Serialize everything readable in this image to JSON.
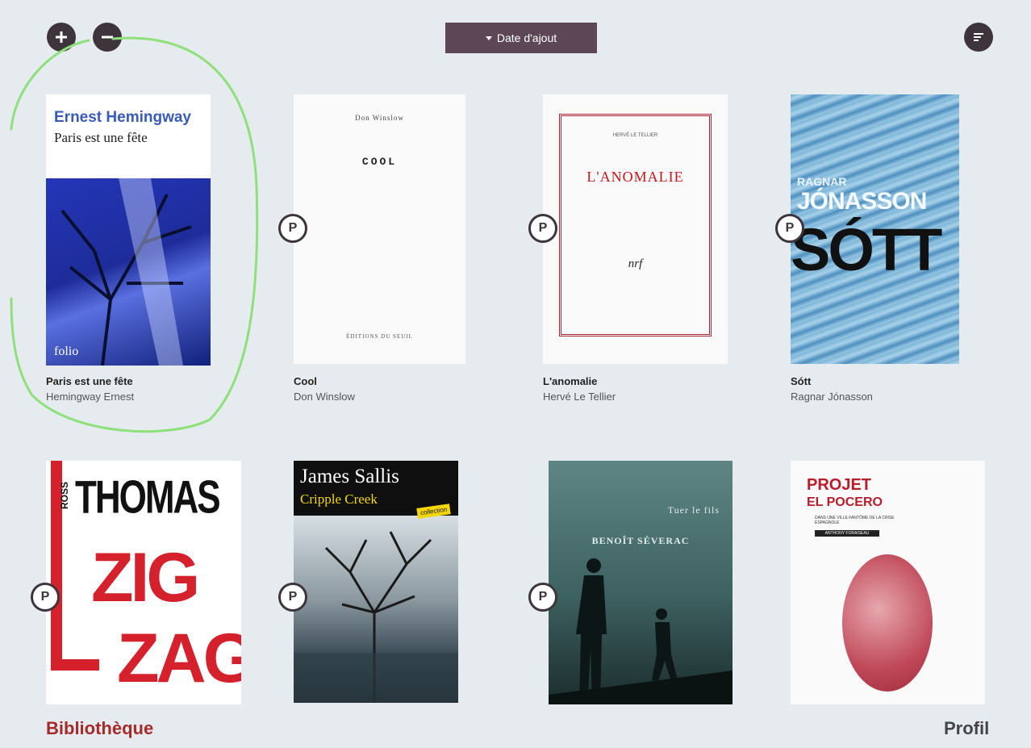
{
  "toolbar": {
    "sort_label": "Date d'ajout"
  },
  "badge_label": "P",
  "books": [
    {
      "title": "Paris est une fête",
      "author": "Hemingway Ernest",
      "cover": {
        "author": "Ernest Hemingway",
        "subtitle": "Paris est une fête",
        "publisher": "folio"
      },
      "has_p_badge": false
    },
    {
      "title": "Cool",
      "author": "Don Winslow",
      "cover": {
        "author": "Don Winslow",
        "title": "COOL",
        "publisher": "ÉDITIONS DU SEUIL"
      },
      "has_p_badge": true
    },
    {
      "title": "L'anomalie",
      "author": "Hervé Le Tellier",
      "cover": {
        "author": "HERVÉ LE TELLIER",
        "title": "L'ANOMALIE",
        "mark": "nrf"
      },
      "has_p_badge": true
    },
    {
      "title": "Sótt",
      "author": "Ragnar Jónasson",
      "cover": {
        "author_first": "RAGNAR",
        "author_last": "JÓNASSON",
        "title": "SÓTT"
      },
      "has_p_badge": true
    },
    {
      "cover": {
        "author_first": "ROSS",
        "author_last": "THOMAS",
        "title_1": "ZIG",
        "title_2": "ZAG"
      },
      "has_p_badge": true
    },
    {
      "cover": {
        "author": "James Sallis",
        "subtitle": "Cripple Creek",
        "badge": "collection"
      },
      "has_p_badge": true
    },
    {
      "cover": {
        "title": "Tuer le fils",
        "author": "BENOÎT SÉVERAC"
      },
      "has_p_badge": true
    },
    {
      "cover": {
        "title_1": "PROJET",
        "title_2": "EL POCERO",
        "subtitle": "DANS UNE VILLE FANTÔME DE LA CRISE ESPAGNOLE",
        "author": "ANTHONY FORAISEAU"
      },
      "has_p_badge": false
    }
  ],
  "nav": {
    "library": "Bibliothèque",
    "profile": "Profil"
  },
  "colors": {
    "background": "#e6ebef",
    "sort_button": "#5d4757",
    "icon_button": "#3d353b",
    "library_link": "#a52a2a",
    "highlight": "#8ee07a"
  }
}
